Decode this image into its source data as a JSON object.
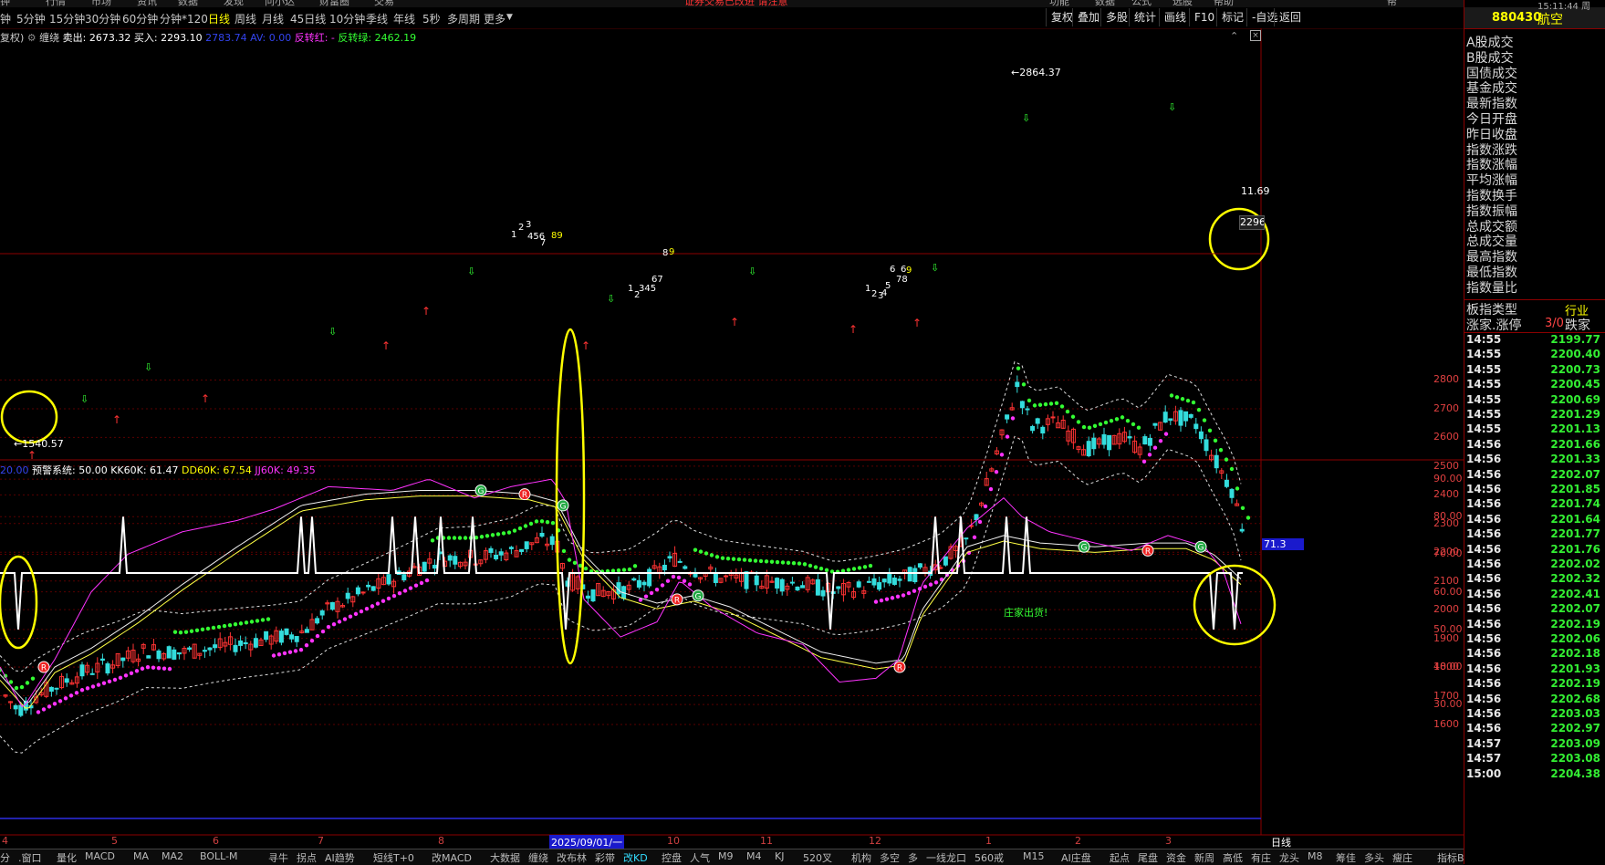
{
  "top_menu": [
    "钟",
    "行情",
    "市场",
    "资讯",
    "数据",
    "发现",
    "问小达",
    "财富圈",
    "交易",
    "功能",
    "数据",
    "公式",
    "选股",
    "帮助",
    "帮"
  ],
  "top_alert": "证券交易已改进 请注意",
  "right_clock": "15:11:44 周",
  "period_tabs": [
    "钟",
    "5分钟",
    "15分钟",
    "30分钟",
    "60分钟",
    "分钟*120",
    "日线",
    "周线",
    "月线",
    "45日线",
    "10分钟",
    "季线",
    "年线",
    "5秒",
    "多周期",
    "更多"
  ],
  "active_period": "日线",
  "toolbar_buttons": [
    "复权",
    "叠加",
    "多股",
    "统计",
    "画线",
    "F10",
    "标记",
    "-自选",
    "返回"
  ],
  "main_indicator": {
    "prefix": "复权)",
    "name": "缠绕",
    "sell": "卖出: 2673.32",
    "buy": "买入: 2293.10",
    "val_blue": "2783.74 AV: 0.00",
    "rev_red": "反转红: -",
    "rev_green": "反转绿: 2462.19"
  },
  "price_axis": [
    "2800",
    "2700",
    "2600",
    "2500",
    "2400",
    "2300",
    "2200",
    "2100",
    "2000",
    "1900",
    "1800",
    "1700",
    "1600"
  ],
  "price_annotations": {
    "high": "2864.37",
    "low": "1540.57",
    "right_value": "11.69",
    "right_price_box": "2296"
  },
  "wave_labels": [
    {
      "t": "1",
      "c": "w"
    },
    {
      "t": "2",
      "c": "w"
    },
    {
      "t": "3",
      "c": "w"
    },
    {
      "t": "456",
      "c": "w"
    },
    {
      "t": "7",
      "c": "w"
    },
    {
      "t": "89",
      "c": "y"
    },
    {
      "t": "8",
      "c": "w"
    },
    {
      "t": "9",
      "c": "y"
    },
    {
      "t": "1",
      "c": "w"
    },
    {
      "t": "2",
      "c": "w"
    },
    {
      "t": "345",
      "c": "w"
    },
    {
      "t": "67",
      "c": "w"
    },
    {
      "t": "1",
      "c": "w"
    },
    {
      "t": "2",
      "c": "w"
    },
    {
      "t": "3",
      "c": "w"
    },
    {
      "t": "4",
      "c": "w"
    },
    {
      "t": "5",
      "c": "w"
    },
    {
      "t": "6",
      "c": "w"
    },
    {
      "t": "78",
      "c": "w"
    },
    {
      "t": "6",
      "c": "w"
    },
    {
      "t": "9",
      "c": "y"
    }
  ],
  "sub_indicator": {
    "val_blue": "20.00",
    "alarm": "预警系统: 50.00",
    "kk": "KK60K: 61.47",
    "dd": "DD60K: 67.54",
    "jj": "JJ60K: 49.35"
  },
  "sub_axis": [
    "90.00",
    "80.00",
    "70.00",
    "60.00",
    "50.00",
    "40.00",
    "30.00"
  ],
  "sub_current": "71.3",
  "sub_annotation": "庄家出货!",
  "date_axis": [
    "4",
    "5",
    "6",
    "7",
    "8",
    "2025/09/01/一",
    "10",
    "11",
    "12",
    "1",
    "2",
    "3",
    "日线"
  ],
  "bottom_tabs": [
    "分",
    ".窗口",
    "量化",
    "MACD",
    "MA",
    "MA2",
    "BOLL-M",
    "寻牛",
    "拐点",
    "AI趋势",
    "短线T+0",
    "改MACD",
    "大数据",
    "缠绕",
    "改布林",
    "彩带",
    "改KD",
    "控盘",
    "人气",
    "M9",
    "M4",
    "KJ",
    "520叉",
    "机构",
    "多空",
    "多",
    "一线龙口",
    "560戒",
    "M15",
    "AI庄盘",
    "起点",
    "尾盘",
    "资金",
    "新周",
    "高低",
    "有庄",
    "龙头",
    "M8",
    "筹佳",
    "多头",
    "瘦庄",
    "",
    "指标B",
    "模",
    "析"
  ],
  "stock_code": "880430",
  "stock_name": "航空",
  "fields": [
    "A股成交",
    "B股成交",
    "国债成交",
    "基金成交",
    "最新指数",
    "今日开盘",
    "昨日收盘",
    "指数涨跌",
    "指数涨幅",
    "平均涨幅",
    "指数换手",
    "指数振幅",
    "总成交额",
    "总成交量",
    "最高指数",
    "最低指数",
    "指数量比"
  ],
  "board_type_label": "板指类型",
  "board_type_value": "行业",
  "updown_label": "涨家.涨停",
  "updown_value": "3/0",
  "down_label": "跌家",
  "ticks": [
    {
      "time": "14:55",
      "price": "2199.77"
    },
    {
      "time": "14:55",
      "price": "2200.40"
    },
    {
      "time": "14:55",
      "price": "2200.73"
    },
    {
      "time": "14:55",
      "price": "2200.45"
    },
    {
      "time": "14:55",
      "price": "2200.69"
    },
    {
      "time": "14:55",
      "price": "2201.29"
    },
    {
      "time": "14:55",
      "price": "2201.13"
    },
    {
      "time": "14:56",
      "price": "2201.66"
    },
    {
      "time": "14:56",
      "price": "2201.33"
    },
    {
      "time": "14:56",
      "price": "2202.07"
    },
    {
      "time": "14:56",
      "price": "2201.85"
    },
    {
      "time": "14:56",
      "price": "2201.74"
    },
    {
      "time": "14:56",
      "price": "2201.64"
    },
    {
      "time": "14:56",
      "price": "2201.77"
    },
    {
      "time": "14:56",
      "price": "2201.76"
    },
    {
      "time": "14:56",
      "price": "2202.02"
    },
    {
      "time": "14:56",
      "price": "2202.32"
    },
    {
      "time": "14:56",
      "price": "2202.41"
    },
    {
      "time": "14:56",
      "price": "2202.07"
    },
    {
      "time": "14:56",
      "price": "2202.19"
    },
    {
      "time": "14:56",
      "price": "2202.06"
    },
    {
      "time": "14:56",
      "price": "2202.18"
    },
    {
      "time": "14:56",
      "price": "2201.93"
    },
    {
      "time": "14:56",
      "price": "2202.19"
    },
    {
      "time": "14:56",
      "price": "2202.68"
    },
    {
      "time": "14:56",
      "price": "2203.03"
    },
    {
      "time": "14:56",
      "price": "2202.97"
    },
    {
      "time": "14:57",
      "price": "2203.09"
    },
    {
      "time": "14:57",
      "price": "2203.08"
    },
    {
      "time": "15:00",
      "price": "2204.38"
    }
  ]
}
